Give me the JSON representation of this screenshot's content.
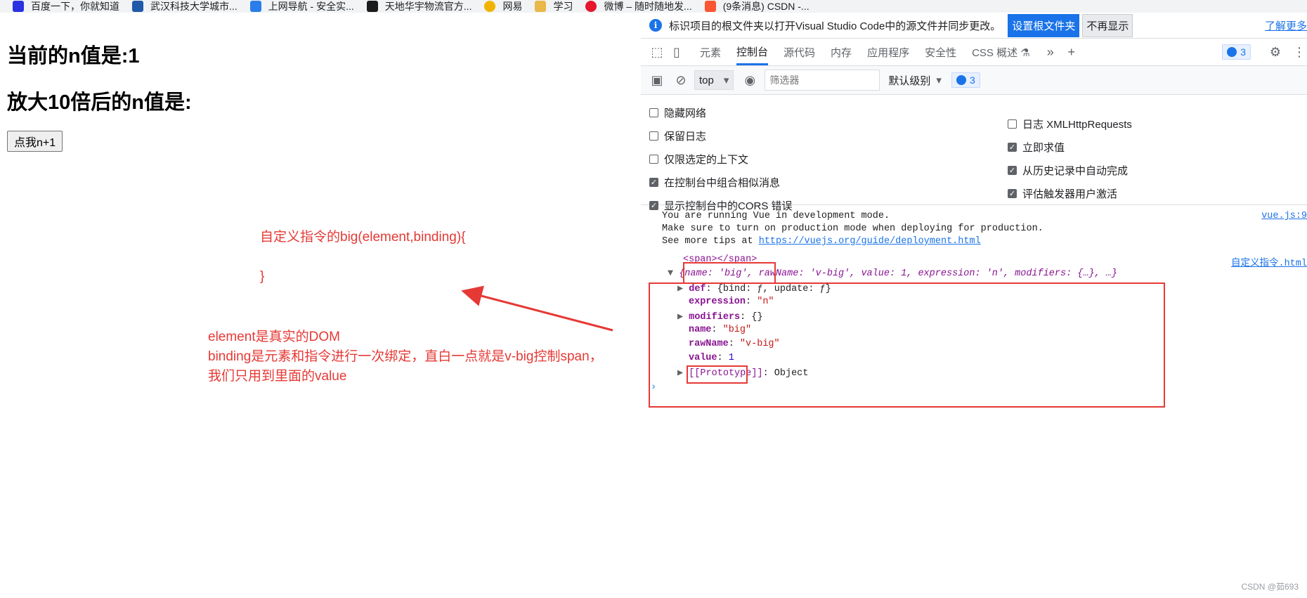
{
  "bookmarks": [
    {
      "label": "百度一下，你就知道",
      "color": "#2932e1"
    },
    {
      "label": "武汉科技大学城市...",
      "color": "#1e5aa8"
    },
    {
      "label": "上网导航 - 安全实...",
      "color": "#2b7de9"
    },
    {
      "label": "天地华宇物流官方...",
      "color": "#1b1b1b"
    },
    {
      "label": "网易",
      "color": "#f0b400"
    },
    {
      "label": "学习",
      "color": "#e8b84a"
    },
    {
      "label": "微博 – 随时随地发...",
      "color": "#e6162d"
    },
    {
      "label": "(9条消息) CSDN -...",
      "color": "#fc5531"
    }
  ],
  "page": {
    "n_text": "当前的n值是:1",
    "big_text": "放大10倍后的n值是:",
    "button_label": "点我n+1"
  },
  "annotations": {
    "note1": "自定义指令的big(element,binding){\n\n}",
    "note2": "element是真实的DOM\nbinding是元素和指令进行一次绑定，直白一点就是v-big控制span，\n我们只用到里面的value"
  },
  "devtools": {
    "infobar": {
      "text": "标识项目的根文件夹以打开Visual Studio Code中的源文件并同步更改。",
      "primary": "设置根文件夹",
      "secondary": "不再显示",
      "learn_more": "了解更多"
    },
    "tabs": [
      "元素",
      "控制台",
      "源代码",
      "内存",
      "应用程序",
      "安全性",
      "CSS 概述"
    ],
    "active_tab": "控制台",
    "msg_count": "3",
    "toolbar": {
      "context": "top",
      "filter_placeholder": "筛选器",
      "level": "默认级别",
      "count": "3"
    },
    "settings_left": [
      {
        "label": "隐藏网络",
        "checked": false
      },
      {
        "label": "保留日志",
        "checked": false
      },
      {
        "label": "仅限选定的上下文",
        "checked": false
      },
      {
        "label": "在控制台中组合相似消息",
        "checked": true
      },
      {
        "label": "显示控制台中的CORS 错误",
        "checked": true
      }
    ],
    "settings_right": [
      {
        "label": "日志 XMLHttpRequests",
        "checked": false
      },
      {
        "label": "立即求值",
        "checked": true
      },
      {
        "label": "从历史记录中自动完成",
        "checked": true
      },
      {
        "label": "评估触发器用户激活",
        "checked": true
      }
    ],
    "console": {
      "vue_line1": "You are running Vue in development mode.",
      "vue_line2": "Make sure to turn on production mode when deploying for production.",
      "vue_line3_prefix": "See more tips at ",
      "vue_line3_link": "https://vuejs.org/guide/deployment.html",
      "vue_src": "vue.js:9",
      "span_line": "<span></span>",
      "span_src": "自定义指令.html",
      "obj_summary": "{name: 'big', rawName: 'v-big', value: 1, expression: 'n', modifiers: {…}, …}",
      "def_key": "def",
      "def_val": "{bind: ƒ, update: ƒ}",
      "expression_key": "expression",
      "expression_val": "\"n\"",
      "modifiers_key": "modifiers",
      "modifiers_val": "{}",
      "name_key": "name",
      "name_val": "\"big\"",
      "rawName_key": "rawName",
      "rawName_val": "\"v-big\"",
      "value_key": "value",
      "value_val": "1",
      "proto_key": "[[Prototype]]",
      "proto_val": "Object"
    }
  },
  "watermark": "CSDN @茹693",
  "colors": {
    "accent": "#1a73e8",
    "annotation": "#e53935"
  }
}
